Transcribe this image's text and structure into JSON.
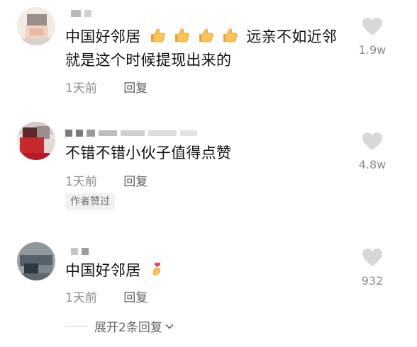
{
  "comments": [
    {
      "text_line1": "中国好邻居",
      "text_after_emoji": "远亲不如近邻",
      "text_line2": "就是这个时候提现出来的",
      "emoji": "thumbs-up-icon",
      "emoji_count": 4,
      "time": "1天前",
      "reply_label": "回复",
      "likes": "1.9w"
    },
    {
      "text_line1": "不错不错小伙子值得点赞",
      "time": "1天前",
      "reply_label": "回复",
      "likes": "4.8w",
      "author_tag": "作者赞过"
    },
    {
      "text_line1": "中国好邻居",
      "emoji": "finger-heart-icon",
      "time": "1天前",
      "reply_label": "回复",
      "likes": "932",
      "expand_label": "展开2条回复"
    }
  ],
  "colors": {
    "primary_text": "#111111",
    "secondary_text": "#8a8a8a",
    "heart": "#d8d8d8"
  }
}
